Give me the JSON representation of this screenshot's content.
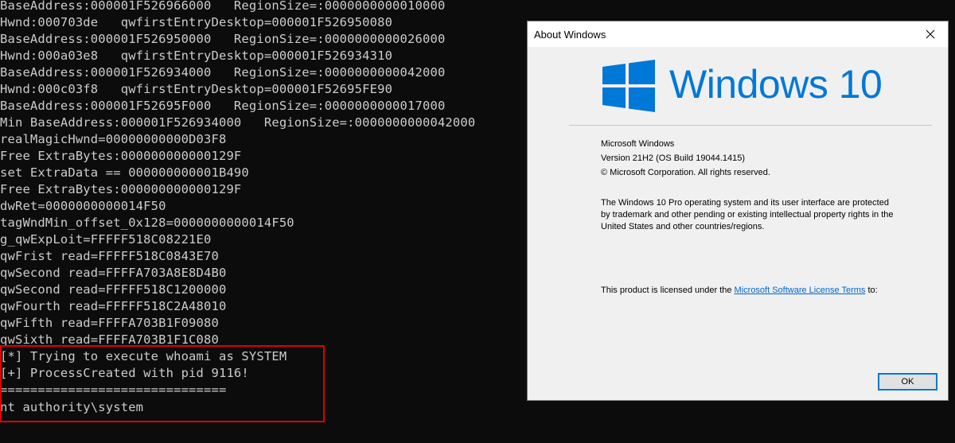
{
  "console": {
    "lines": [
      "BaseAddress:000001F526966000   RegionSize=:0000000000010000",
      "Hwnd:000703de   qwfirstEntryDesktop=000001F526950080",
      "BaseAddress:000001F526950000   RegionSize=:0000000000026000",
      "Hwnd:000a03e8   qwfirstEntryDesktop=000001F526934310",
      "BaseAddress:000001F526934000   RegionSize=:0000000000042000",
      "Hwnd:000c03f8   qwfirstEntryDesktop=000001F52695FE90",
      "BaseAddress:000001F52695F000   RegionSize=:0000000000017000",
      "Min BaseAddress:000001F526934000   RegionSize=:0000000000042000",
      "realMagicHwnd=00000000000D03F8",
      "Free ExtraBytes:000000000000129F",
      "set ExtraData == 000000000001B490",
      "Free ExtraBytes:000000000000129F",
      "dwRet=0000000000014F50",
      "tagWndMin_offset_0x128=0000000000014F50",
      "g_qwExpLoit=FFFFF518C08221E0",
      "qwFrist read=FFFFF518C0843E70",
      "qwSecond read=FFFFA703A8E8D4B0",
      "qwSecond read=FFFFF518C1200000",
      "qwFourth read=FFFFF518C2A48010",
      "qwFifth read=FFFFA703B1F09080",
      "qwSixth read=FFFFA703B1F1C080",
      "[*] Trying to execute whoami as SYSTEM",
      "[+] ProcessCreated with pid 9116!",
      "==============================",
      "nt authority\\system"
    ]
  },
  "about": {
    "title": "About Windows",
    "logo_text": "Windows 10",
    "product": "Microsoft Windows",
    "version": "Version 21H2 (OS Build 19044.1415)",
    "copyright": "© Microsoft Corporation. All rights reserved.",
    "description": "The Windows 10 Pro operating system and its user interface are protected by trademark and other pending or existing intellectual property rights in the United States and other countries/regions.",
    "license_prefix": "This product is licensed under the ",
    "license_link": "Microsoft Software License Terms",
    "license_suffix": " to:",
    "ok_label": "OK"
  },
  "colors": {
    "console_bg": "#0c0c0c",
    "console_text": "#cccccc",
    "highlight_border": "#e00000",
    "windows_blue": "#0078d7",
    "link": "#0066cc"
  },
  "icons": {
    "close": "close-icon",
    "logo": "windows-logo-icon"
  }
}
